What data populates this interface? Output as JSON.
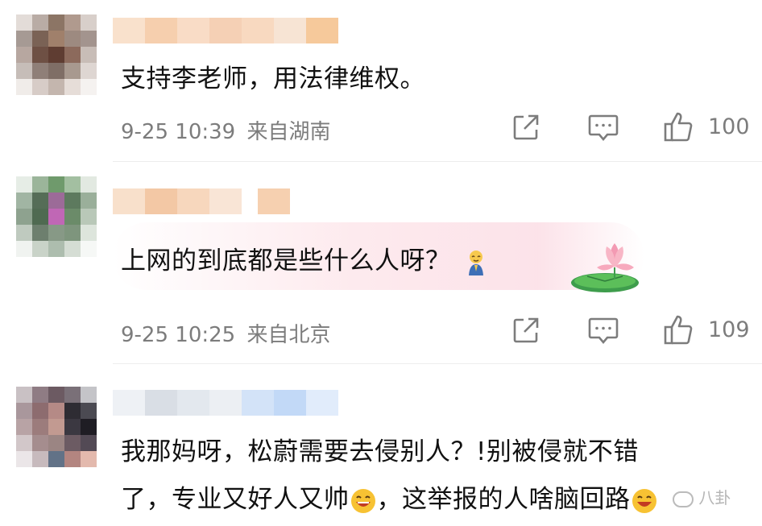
{
  "comments": [
    {
      "text": "支持李老师，用法律维权。",
      "time": "9-25 10:39",
      "location": "来自湖南",
      "likes": "100"
    },
    {
      "text": "上网的到底都是些什么人呀？",
      "time": "9-25 10:25",
      "location": "来自北京",
      "likes": "109"
    },
    {
      "text_line1": "我那妈呀，松蔚需要去侵别人？!别被侵就不错",
      "text_line2": "了，专业又好人又帅",
      "text_line2_tail": "，这举报的人啥脑回路"
    }
  ],
  "watermark": "八卦",
  "icons": [
    "share-icon",
    "comment-icon",
    "like-icon",
    "laughing-emoji-icon",
    "praying-emoji-icon",
    "lotus-icon"
  ],
  "colors": {
    "text": "#111111",
    "meta": "#7c7c7c",
    "highlight": "#fce1e8"
  }
}
